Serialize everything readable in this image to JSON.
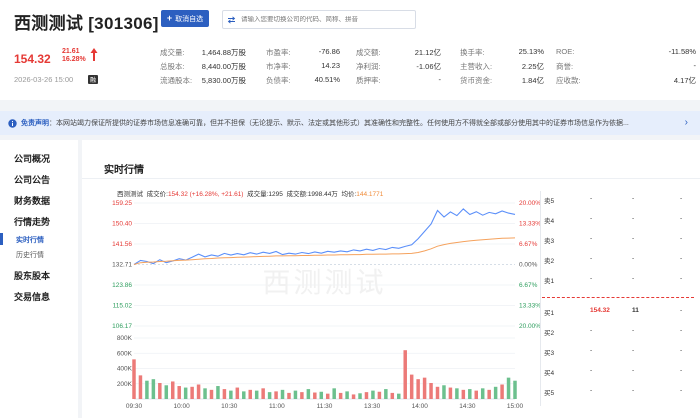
{
  "header": {
    "stock_name": "西测测试",
    "stock_code": "[301306]",
    "title": "西测测试 [301306]",
    "fav_label": "取消自选",
    "search_placeholder": "请输入您要切换公司的代码、简称、拼音",
    "price": "154.32",
    "change_abs": "21.61",
    "change_pct": "16.28%",
    "datetime": "2026-03-26 15:00",
    "margin_tag": "融",
    "colors": {
      "up": "#e53935",
      "accent": "#2c5fc0"
    }
  },
  "stats": [
    [
      {
        "k": "成交量:",
        "v": "1,464.88万股"
      },
      {
        "k": "市盈率:",
        "v": "-76.86"
      },
      {
        "k": "成交额:",
        "v": "21.12亿"
      },
      {
        "k": "换手率:",
        "v": "25.13%"
      },
      {
        "k": "ROE:",
        "v": "-11.58%"
      }
    ],
    [
      {
        "k": "总股本:",
        "v": "8,440.00万股"
      },
      {
        "k": "市净率:",
        "v": "14.23"
      },
      {
        "k": "净利润:",
        "v": "-1.06亿"
      },
      {
        "k": "主营收入:",
        "v": "2.25亿"
      },
      {
        "k": "商誉:",
        "v": "-"
      }
    ],
    [
      {
        "k": "流通股本:",
        "v": "5,830.00万股"
      },
      {
        "k": "负债率:",
        "v": "40.51%"
      },
      {
        "k": "质押率:",
        "v": "-"
      },
      {
        "k": "货币资金:",
        "v": "1.84亿"
      },
      {
        "k": "应收款:",
        "v": "4.17亿"
      }
    ]
  ],
  "notice": {
    "label": "免责声明",
    "text": "：本网站竭力保证所提供的证券市场信息准确可靠，但并不担保（无论提示、默示、法定或其他形式）其准确性和完整性。任何使用方不得就全部或部分使用其中的证券市场信息作为依据..."
  },
  "sidebar": {
    "items": [
      {
        "label": "公司概况"
      },
      {
        "label": "公司公告"
      },
      {
        "label": "财务数据"
      },
      {
        "label": "行情走势"
      },
      {
        "label": "实时行情",
        "sub": true,
        "active": true
      },
      {
        "label": "历史行情",
        "sub": true
      },
      {
        "label": "股东股本"
      },
      {
        "label": "交易信息"
      }
    ]
  },
  "main": {
    "title": "实时行情",
    "watermark": "西测测试",
    "legend": {
      "name": "西测测试",
      "price_label": "成交价:",
      "price_value": "154.32 (+16.28%, +21.61)",
      "vol_label": "成交量:",
      "vol_value": "1295",
      "amt_label": "成交额:",
      "amt_value": "1998.44万",
      "avg_label": "均价:",
      "avg_value": "144.1771"
    }
  },
  "chart_data": {
    "type": "line",
    "price_axis": [
      "159.25",
      "150.40",
      "141.56",
      "132.71",
      "123.86",
      "115.02",
      "106.17"
    ],
    "pct_axis": [
      "20.00%",
      "13.33%",
      "6.67%",
      "0.00%",
      "6.67%",
      "13.33%",
      "20.00%"
    ],
    "volume_axis": [
      "800K",
      "600K",
      "400K",
      "200K"
    ],
    "time_axis": [
      "09:30",
      "10:00",
      "10:30",
      "11:00",
      "11:30",
      "13:30",
      "14:00",
      "14:30",
      "15:00"
    ],
    "ylim": [
      106.17,
      159.25
    ],
    "prev_close": 132.71,
    "series": [
      {
        "name": "成交价",
        "color": "#5b8ff9",
        "values": [
          132.7,
          134.5,
          134.0,
          133.1,
          134.8,
          133.5,
          134.2,
          135.2,
          134.6,
          135.8,
          137.2,
          136.0,
          136.8,
          136.3,
          137.5,
          136.8,
          137.4,
          136.9,
          137.8,
          137.2,
          138.0,
          137.5,
          138.3,
          137.0,
          137.6,
          137.2,
          137.9,
          137.4,
          138.1,
          137.6,
          138.4,
          138.0,
          138.6,
          138.2,
          139.0,
          138.6,
          139.3,
          138.8,
          139.6,
          139.2,
          140.1,
          139.7,
          140.5,
          141.2,
          143.8,
          147.0,
          150.2,
          156.0,
          153.2,
          155.4,
          153.8,
          156.7,
          154.3,
          155.5,
          154.0,
          155.2,
          154.6,
          155.8,
          154.9,
          154.32
        ]
      },
      {
        "name": "均价",
        "color": "#f5a25d",
        "values": [
          132.7,
          133.5,
          133.7,
          133.8,
          134.0,
          134.1,
          134.3,
          134.5,
          134.6,
          134.8,
          135.0,
          135.2,
          135.3,
          135.5,
          135.6,
          135.7,
          135.8,
          135.9,
          136.0,
          136.1,
          136.2,
          136.3,
          136.4,
          136.4,
          136.5,
          136.5,
          136.6,
          136.6,
          136.7,
          136.7,
          136.8,
          136.8,
          136.9,
          136.9,
          137.0,
          137.0,
          137.1,
          137.1,
          137.2,
          137.2,
          137.3,
          137.3,
          137.4,
          137.5,
          137.9,
          138.6,
          139.5,
          140.6,
          141.3,
          141.8,
          142.2,
          142.6,
          142.9,
          143.2,
          143.4,
          143.6,
          143.8,
          144.0,
          144.1,
          144.18
        ]
      }
    ],
    "volume": [
      520,
      310,
      240,
      260,
      210,
      180,
      230,
      170,
      150,
      160,
      190,
      140,
      120,
      170,
      130,
      110,
      150,
      100,
      120,
      110,
      140,
      90,
      100,
      120,
      80,
      110,
      90,
      130,
      85,
      95,
      70,
      140,
      80,
      100,
      60,
      75,
      90,
      110,
      95,
      130,
      80,
      70,
      640,
      320,
      260,
      280,
      210,
      160,
      180,
      150,
      140,
      120,
      130,
      110,
      140,
      120,
      160,
      190,
      280,
      240
    ],
    "orderbook": {
      "sells": [
        {
          "l": "卖5",
          "p": "-",
          "q": "-"
        },
        {
          "l": "卖4",
          "p": "-",
          "q": "-"
        },
        {
          "l": "卖3",
          "p": "-",
          "q": "-"
        },
        {
          "l": "卖2",
          "p": "-",
          "q": "-"
        },
        {
          "l": "卖1",
          "p": "-",
          "q": "-"
        }
      ],
      "buys": [
        {
          "l": "买1",
          "p": "154.32",
          "q": "11"
        },
        {
          "l": "买2",
          "p": "-",
          "q": "-"
        },
        {
          "l": "买3",
          "p": "-",
          "q": "-"
        },
        {
          "l": "买4",
          "p": "-",
          "q": "-"
        },
        {
          "l": "买5",
          "p": "-",
          "q": "-"
        }
      ]
    }
  }
}
